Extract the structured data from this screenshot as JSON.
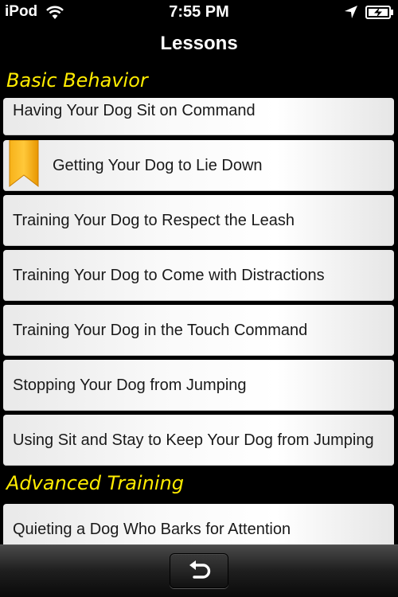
{
  "status_bar": {
    "carrier": "iPod",
    "time": "7:55 PM",
    "icons": [
      "wifi-icon",
      "location-arrow-icon",
      "battery-charging-icon"
    ]
  },
  "nav": {
    "title": "Lessons"
  },
  "sections": [
    {
      "title": "Basic Behavior",
      "items": [
        {
          "label": "Having Your Dog Sit on Command",
          "bookmarked": false
        },
        {
          "label": "Getting Your Dog to Lie Down",
          "bookmarked": true
        },
        {
          "label": "Training Your Dog to Respect the Leash",
          "bookmarked": false
        },
        {
          "label": "Training Your Dog to Come with Distractions",
          "bookmarked": false
        },
        {
          "label": "Training Your Dog in the Touch Command",
          "bookmarked": false
        },
        {
          "label": "Stopping Your Dog from Jumping",
          "bookmarked": false
        },
        {
          "label": "Using Sit and Stay to Keep Your Dog from Jumping",
          "bookmarked": false
        }
      ]
    },
    {
      "title": "Advanced Training",
      "items": [
        {
          "label": "Quieting a Dog Who Barks for Attention",
          "bookmarked": false
        }
      ]
    }
  ],
  "colors": {
    "section_header_text": "#ffec00",
    "bookmark_ribbon": "#f5a800",
    "background": "#000000"
  },
  "toolbar": {
    "back_icon": "back-arrow-icon"
  }
}
